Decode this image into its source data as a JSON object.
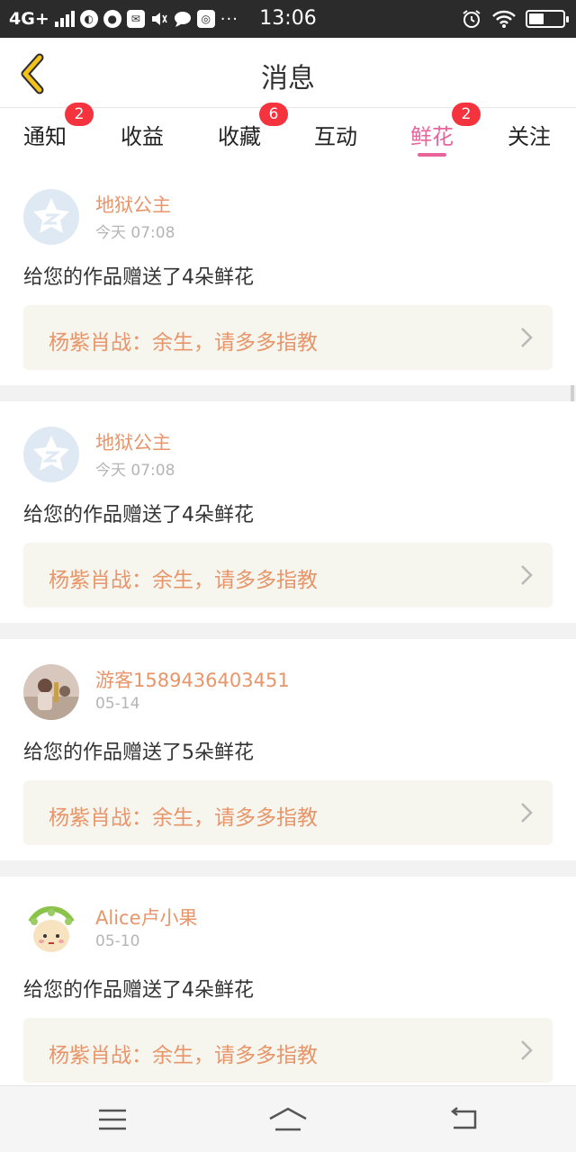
{
  "status_bar": {
    "network": "4G+",
    "time": "13:06",
    "battery_level": 0.45
  },
  "header": {
    "title": "消息"
  },
  "tabs": [
    {
      "label": "通知",
      "badge": "2",
      "active": false
    },
    {
      "label": "收益",
      "badge": "",
      "active": false
    },
    {
      "label": "收藏",
      "badge": "6",
      "active": false
    },
    {
      "label": "互动",
      "badge": "",
      "active": false
    },
    {
      "label": "鲜花",
      "badge": "2",
      "active": true
    },
    {
      "label": "关注",
      "badge": "",
      "active": false
    }
  ],
  "messages": [
    {
      "user": "地狱公主",
      "time": "今天 07:08",
      "text": "给您的作品赠送了4朵鲜花",
      "work": "杨紫肖战：余生，请多多指教",
      "avatar": "default-qq-avatar"
    },
    {
      "user": "地狱公主",
      "time": "今天 07:08",
      "text": "给您的作品赠送了4朵鲜花",
      "work": "杨紫肖战：余生，请多多指教",
      "avatar": "default-qq-avatar"
    },
    {
      "user": "游客1589436403451",
      "time": "05-14",
      "text": "给您的作品赠送了5朵鲜花",
      "work": "杨紫肖战：余生，请多多指教",
      "avatar": "photo-avatar"
    },
    {
      "user": "Alice卢小果",
      "time": "05-10",
      "text": "给您的作品赠送了4朵鲜花",
      "work": "杨紫肖战：余生，请多多指教",
      "avatar": "cartoon-avatar"
    }
  ],
  "colors": {
    "accent": "#e8649a",
    "name": "#e8956a",
    "badge": "#f5333f",
    "back_icon": "#f2c21b"
  }
}
